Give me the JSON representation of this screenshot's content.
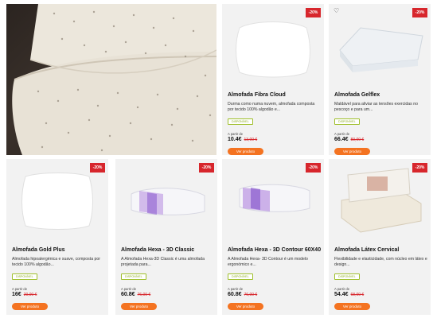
{
  "products": [
    {
      "name": "Almofada Fibra Cloud",
      "description": "Durma como numa nuvem, almofada composta por tecido 100% algodão e...",
      "badge": "-20%",
      "stock": "DISPONÍVEL",
      "from_label": "A partir de",
      "price": "10.4€",
      "old_price": "13,00 €",
      "button": "Ver produto"
    },
    {
      "name": "Almofada Gelflex",
      "description": "Maldável para aliviar as tensões exercidas no pescoço e para um...",
      "badge": "-20%",
      "heart_icon": "♡",
      "stock": "DISPONÍVEL",
      "from_label": "A partir de",
      "price": "66.4€",
      "old_price": "83,00 €",
      "button": "Ver produto"
    },
    {
      "name": "Almofada Gold Plus",
      "description": "Almofada hipoalergénica e suave, composta por tecido 100% algodão...",
      "badge": "-20%",
      "stock": "DISPONÍVEL",
      "from_label": "A partir de",
      "price": "16€",
      "old_price": "20,00 €",
      "button": "Ver produto"
    },
    {
      "name": "Almofada Hexa - 3D Classic",
      "description": "A Almofada Hexa-3D Classic é uma almofada projetada para...",
      "badge": "-20%",
      "stock": "DISPONÍVEL",
      "from_label": "A partir de",
      "price": "60.8€",
      "old_price": "76,00 €",
      "button": "Ver produto"
    },
    {
      "name": "Almofada Hexa - 3D Contour 60X40",
      "description": "A Almofada Hexa- 3D Contour é um modelo ergonómico e...",
      "badge": "-20%",
      "stock": "DISPONÍVEL",
      "from_label": "A partir de",
      "price": "60.8€",
      "old_price": "76,00 €",
      "button": "Ver produto"
    },
    {
      "name": "Almofada Látex Cervical",
      "description": "Flexibilidade e elasticidade, com núcleo em látex e design...",
      "badge": "-20%",
      "stock": "DISPONÍVEL",
      "from_label": "A partir de",
      "price": "54.4€",
      "old_price": "68,00 €",
      "button": "Ver produto"
    }
  ],
  "colors": {
    "accent": "#f47321",
    "badge": "#d7262c",
    "card_bg": "#f2f2f2",
    "stock": "#8aaa1a"
  }
}
